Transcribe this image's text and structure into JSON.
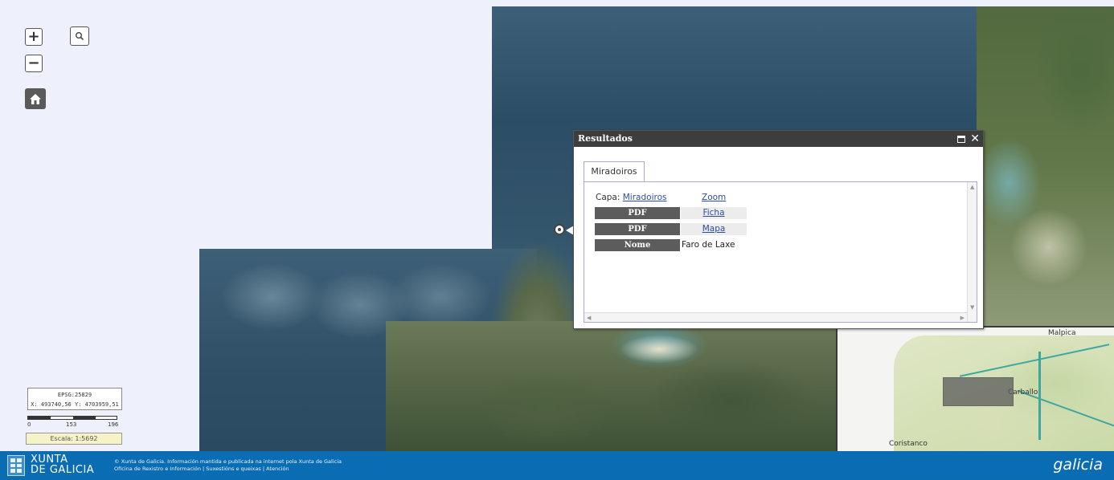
{
  "map": {
    "zoom_in_label": "+",
    "zoom_out_label": "−",
    "search_icon": "search-icon",
    "home_icon": "home-icon",
    "coords": {
      "line1": "EPSG:25829",
      "line2": "X: 493740,56 Y: 4703959,51"
    },
    "scale": {
      "left_label": "0",
      "mid_label": "153",
      "right_label": "196"
    },
    "escala": "Escala: 1:5692"
  },
  "popup": {
    "title": "Resultados",
    "maximize_icon": "maximize-icon",
    "close_label": "✕",
    "tab_label": "Miradoiros",
    "capa_label": "Capa:",
    "capa_link": "Miradoiros",
    "zoom_link": "Zoom",
    "rows": [
      {
        "label": "PDF",
        "value": "Ficha",
        "is_link": true
      },
      {
        "label": "PDF",
        "value": "Mapa",
        "is_link": true
      },
      {
        "label": "Nome",
        "value": "Faro de Laxe",
        "is_link": false
      }
    ]
  },
  "overview": {
    "labels": [
      "Malpica",
      "Carballo",
      "Coristanco"
    ]
  },
  "footer": {
    "brand_line1": "XUNTA",
    "brand_line2": "DE GALICIA",
    "info_line1": "© Xunta de Galicia. Información mantida e publicada na internet pola Xunta de Galicia",
    "info_line2": "Oficina de Rexistro e Información | Suxestións e queixas | Atención",
    "galicia": "galicia"
  },
  "colors": {
    "footer_bg": "#0a6db3",
    "titlebar_bg": "#3d3d3d",
    "label_dark": "#5c5c5c",
    "link": "#2a4ea0"
  }
}
